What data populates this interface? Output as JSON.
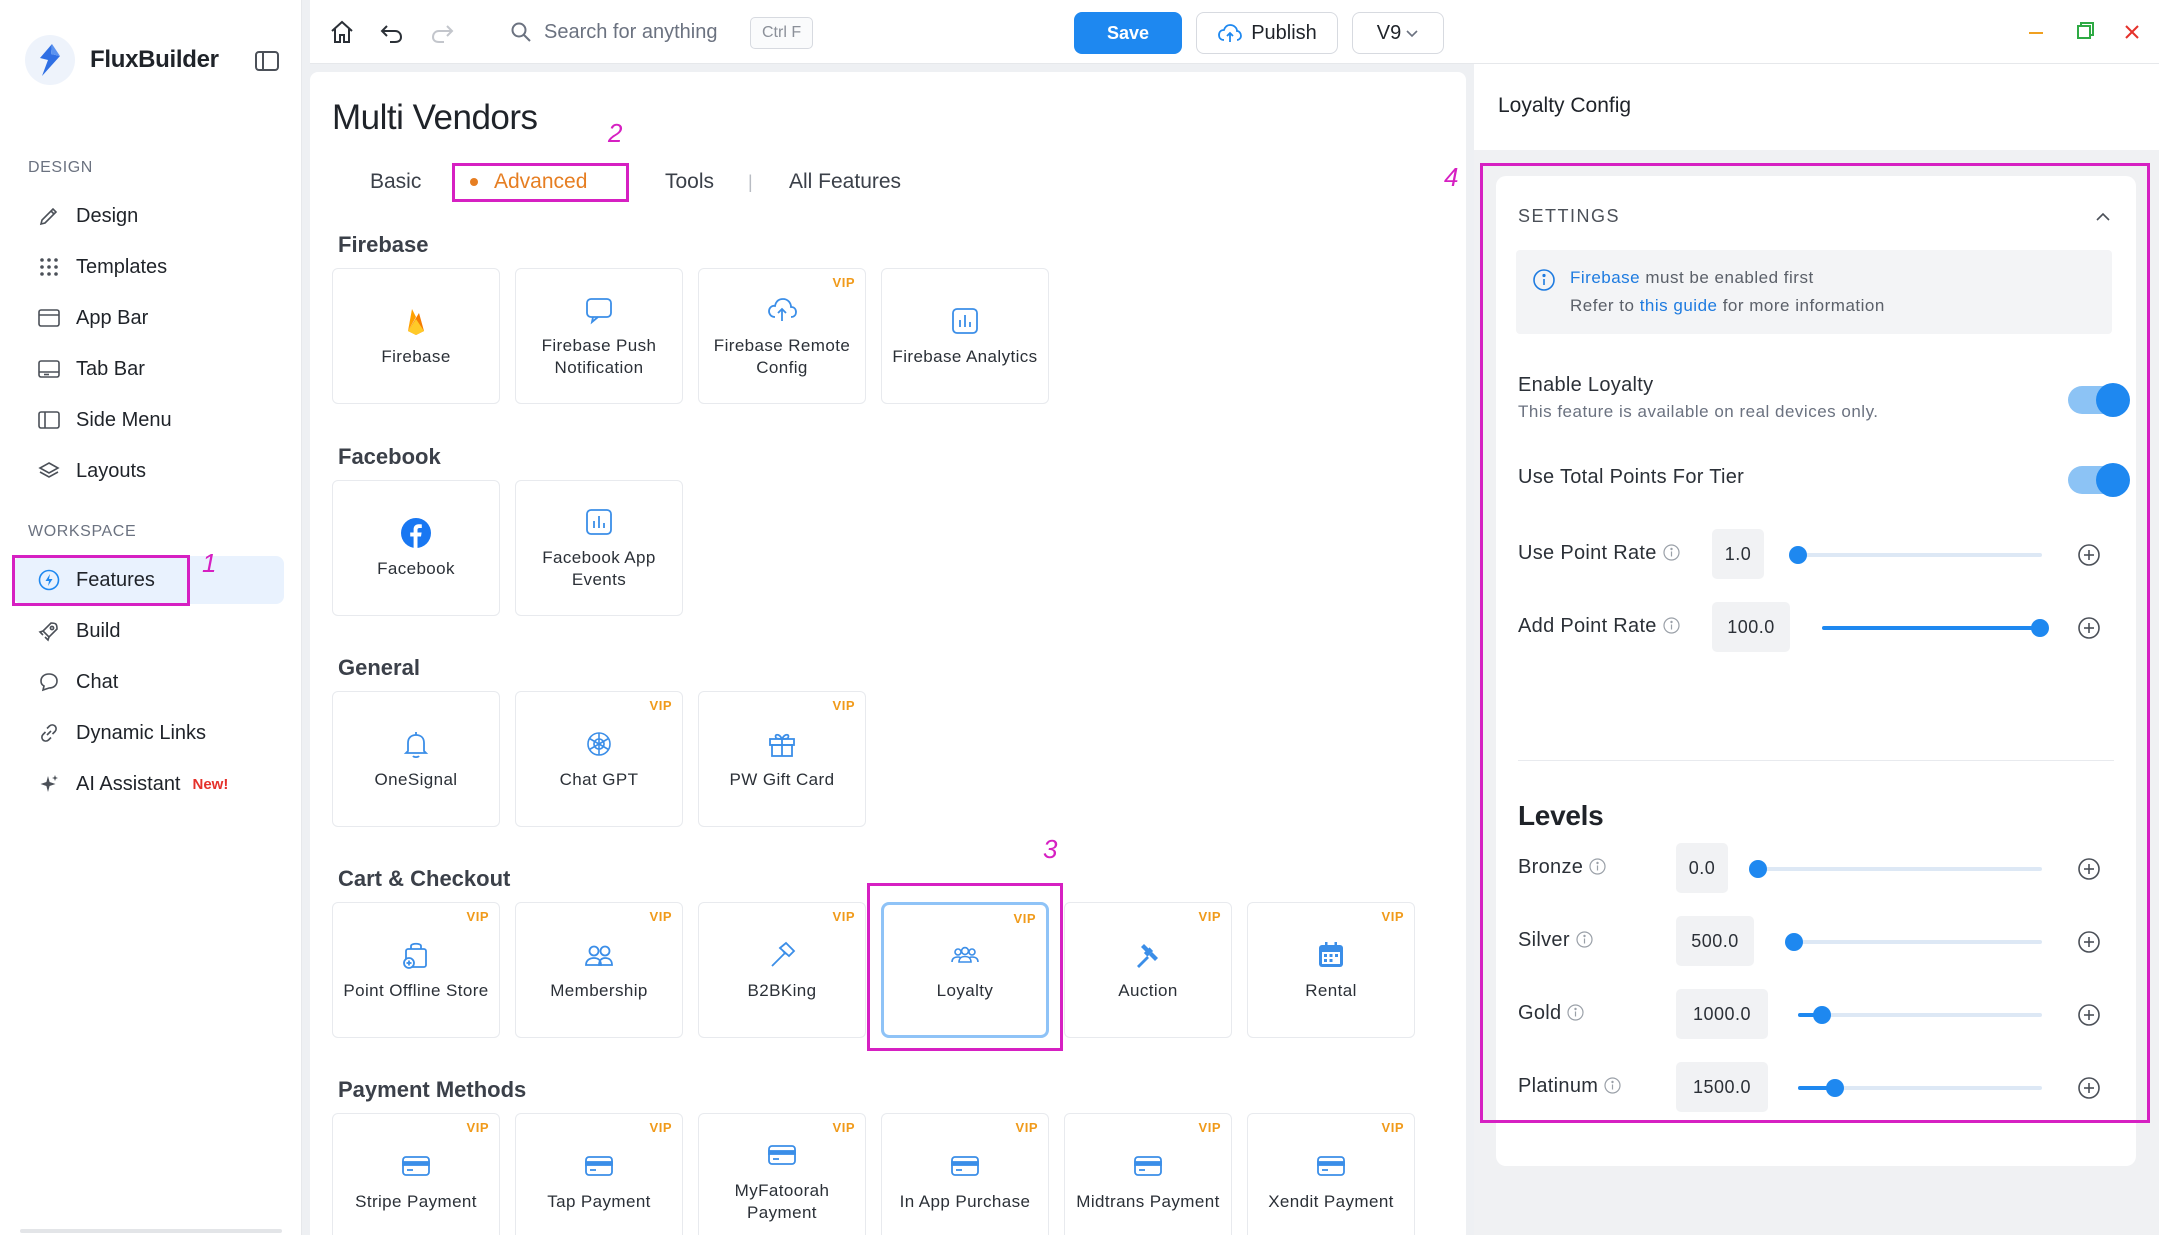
{
  "app": {
    "name": "FluxBuilder"
  },
  "sidebar": {
    "design_label": "DESIGN",
    "workspace_label": "WORKSPACE",
    "design_items": [
      {
        "label": "Design",
        "icon": "brush-icon"
      },
      {
        "label": "Templates",
        "icon": "grid-icon"
      },
      {
        "label": "App Bar",
        "icon": "app-bar-icon"
      },
      {
        "label": "Tab Bar",
        "icon": "tab-bar-icon"
      },
      {
        "label": "Side Menu",
        "icon": "side-menu-icon"
      },
      {
        "label": "Layouts",
        "icon": "layers-icon"
      }
    ],
    "workspace_items": [
      {
        "label": "Features",
        "icon": "bolt-icon",
        "active": true
      },
      {
        "label": "Build",
        "icon": "rocket-icon"
      },
      {
        "label": "Chat",
        "icon": "chat-icon"
      },
      {
        "label": "Dynamic Links",
        "icon": "link-icon"
      },
      {
        "label": "AI Assistant",
        "icon": "sparkle-icon",
        "badge": "New!"
      }
    ]
  },
  "topbar": {
    "search_placeholder": "Search for anything",
    "shortcut": "Ctrl F",
    "save_label": "Save",
    "publish_label": "Publish",
    "version_label": "V9"
  },
  "main": {
    "title": "Multi Vendors",
    "tabs": [
      "Basic",
      "Advanced",
      "Tools",
      "All Features"
    ],
    "active_tab": "Advanced",
    "vip_label": "VIP",
    "groups": [
      {
        "title": "Firebase",
        "cards": [
          {
            "label": "Firebase",
            "icon": "firebase-icon",
            "vip": false
          },
          {
            "label": "Firebase Push Notification",
            "icon": "chat-bubble-icon",
            "vip": false
          },
          {
            "label": "Firebase Remote Config",
            "icon": "cloud-upload-icon",
            "vip": true
          },
          {
            "label": "Firebase Analytics",
            "icon": "analytics-icon",
            "vip": false
          }
        ]
      },
      {
        "title": "Facebook",
        "cards": [
          {
            "label": "Facebook",
            "icon": "facebook-icon",
            "vip": false
          },
          {
            "label": "Facebook App Events",
            "icon": "analytics-icon",
            "vip": false
          }
        ]
      },
      {
        "title": "General",
        "cards": [
          {
            "label": "OneSignal",
            "icon": "bell-icon",
            "vip": false
          },
          {
            "label": "Chat GPT",
            "icon": "openai-icon",
            "vip": true
          },
          {
            "label": "PW Gift Card",
            "icon": "gift-icon",
            "vip": true
          }
        ]
      },
      {
        "title": "Cart & Checkout",
        "cards": [
          {
            "label": "Point Offline Store",
            "icon": "store-bag-icon",
            "vip": true
          },
          {
            "label": "Membership",
            "icon": "users-icon",
            "vip": true
          },
          {
            "label": "B2BKing",
            "icon": "hammer-icon",
            "vip": true
          },
          {
            "label": "Loyalty",
            "icon": "group-icon",
            "vip": true,
            "selected": true
          },
          {
            "label": "Auction",
            "icon": "gavel-icon",
            "vip": true
          },
          {
            "label": "Rental",
            "icon": "calendar-icon",
            "vip": true
          }
        ]
      },
      {
        "title": "Payment Methods",
        "cards": [
          {
            "label": "Stripe Payment",
            "icon": "card-icon",
            "vip": true
          },
          {
            "label": "Tap Payment",
            "icon": "card-icon",
            "vip": true
          },
          {
            "label": "MyFatoorah Payment",
            "icon": "card-icon",
            "vip": true
          },
          {
            "label": "In App Purchase",
            "icon": "card-icon",
            "vip": true
          },
          {
            "label": "Midtrans Payment",
            "icon": "card-icon",
            "vip": true
          },
          {
            "label": "Xendit Payment",
            "icon": "card-icon",
            "vip": true
          }
        ]
      }
    ]
  },
  "right_panel": {
    "title": "Loyalty Config",
    "settings_label": "SETTINGS",
    "info": {
      "line1_link": "Firebase",
      "line1_rest": " must be enabled first",
      "line2_pre": "Refer to ",
      "line2_link": "this guide",
      "line2_post": " for more information"
    },
    "enable_loyalty": {
      "label": "Enable Loyalty",
      "sub": "This feature is available on real devices only.",
      "on": true
    },
    "use_total_points": {
      "label": "Use Total Points For Tier",
      "on": true
    },
    "rates": [
      {
        "label": "Use Point Rate",
        "value": "1.0",
        "fraction": 0.0
      },
      {
        "label": "Add Point Rate",
        "value": "100.0",
        "fraction": 1.0
      }
    ],
    "levels_title": "Levels",
    "levels": [
      {
        "label": "Bronze",
        "value": "0.0",
        "fraction": 0.0
      },
      {
        "label": "Silver",
        "value": "500.0",
        "fraction": 0.03
      },
      {
        "label": "Gold",
        "value": "1000.0",
        "fraction": 0.1
      },
      {
        "label": "Platinum",
        "value": "1500.0",
        "fraction": 0.15
      }
    ]
  },
  "annotations": [
    "1",
    "2",
    "3",
    "4"
  ],
  "colors": {
    "accent": "#1e88f0",
    "active_tab": "#e67e22",
    "vip": "#f09a1a",
    "annotation": "#d620c2",
    "badge": "#e5312b"
  }
}
